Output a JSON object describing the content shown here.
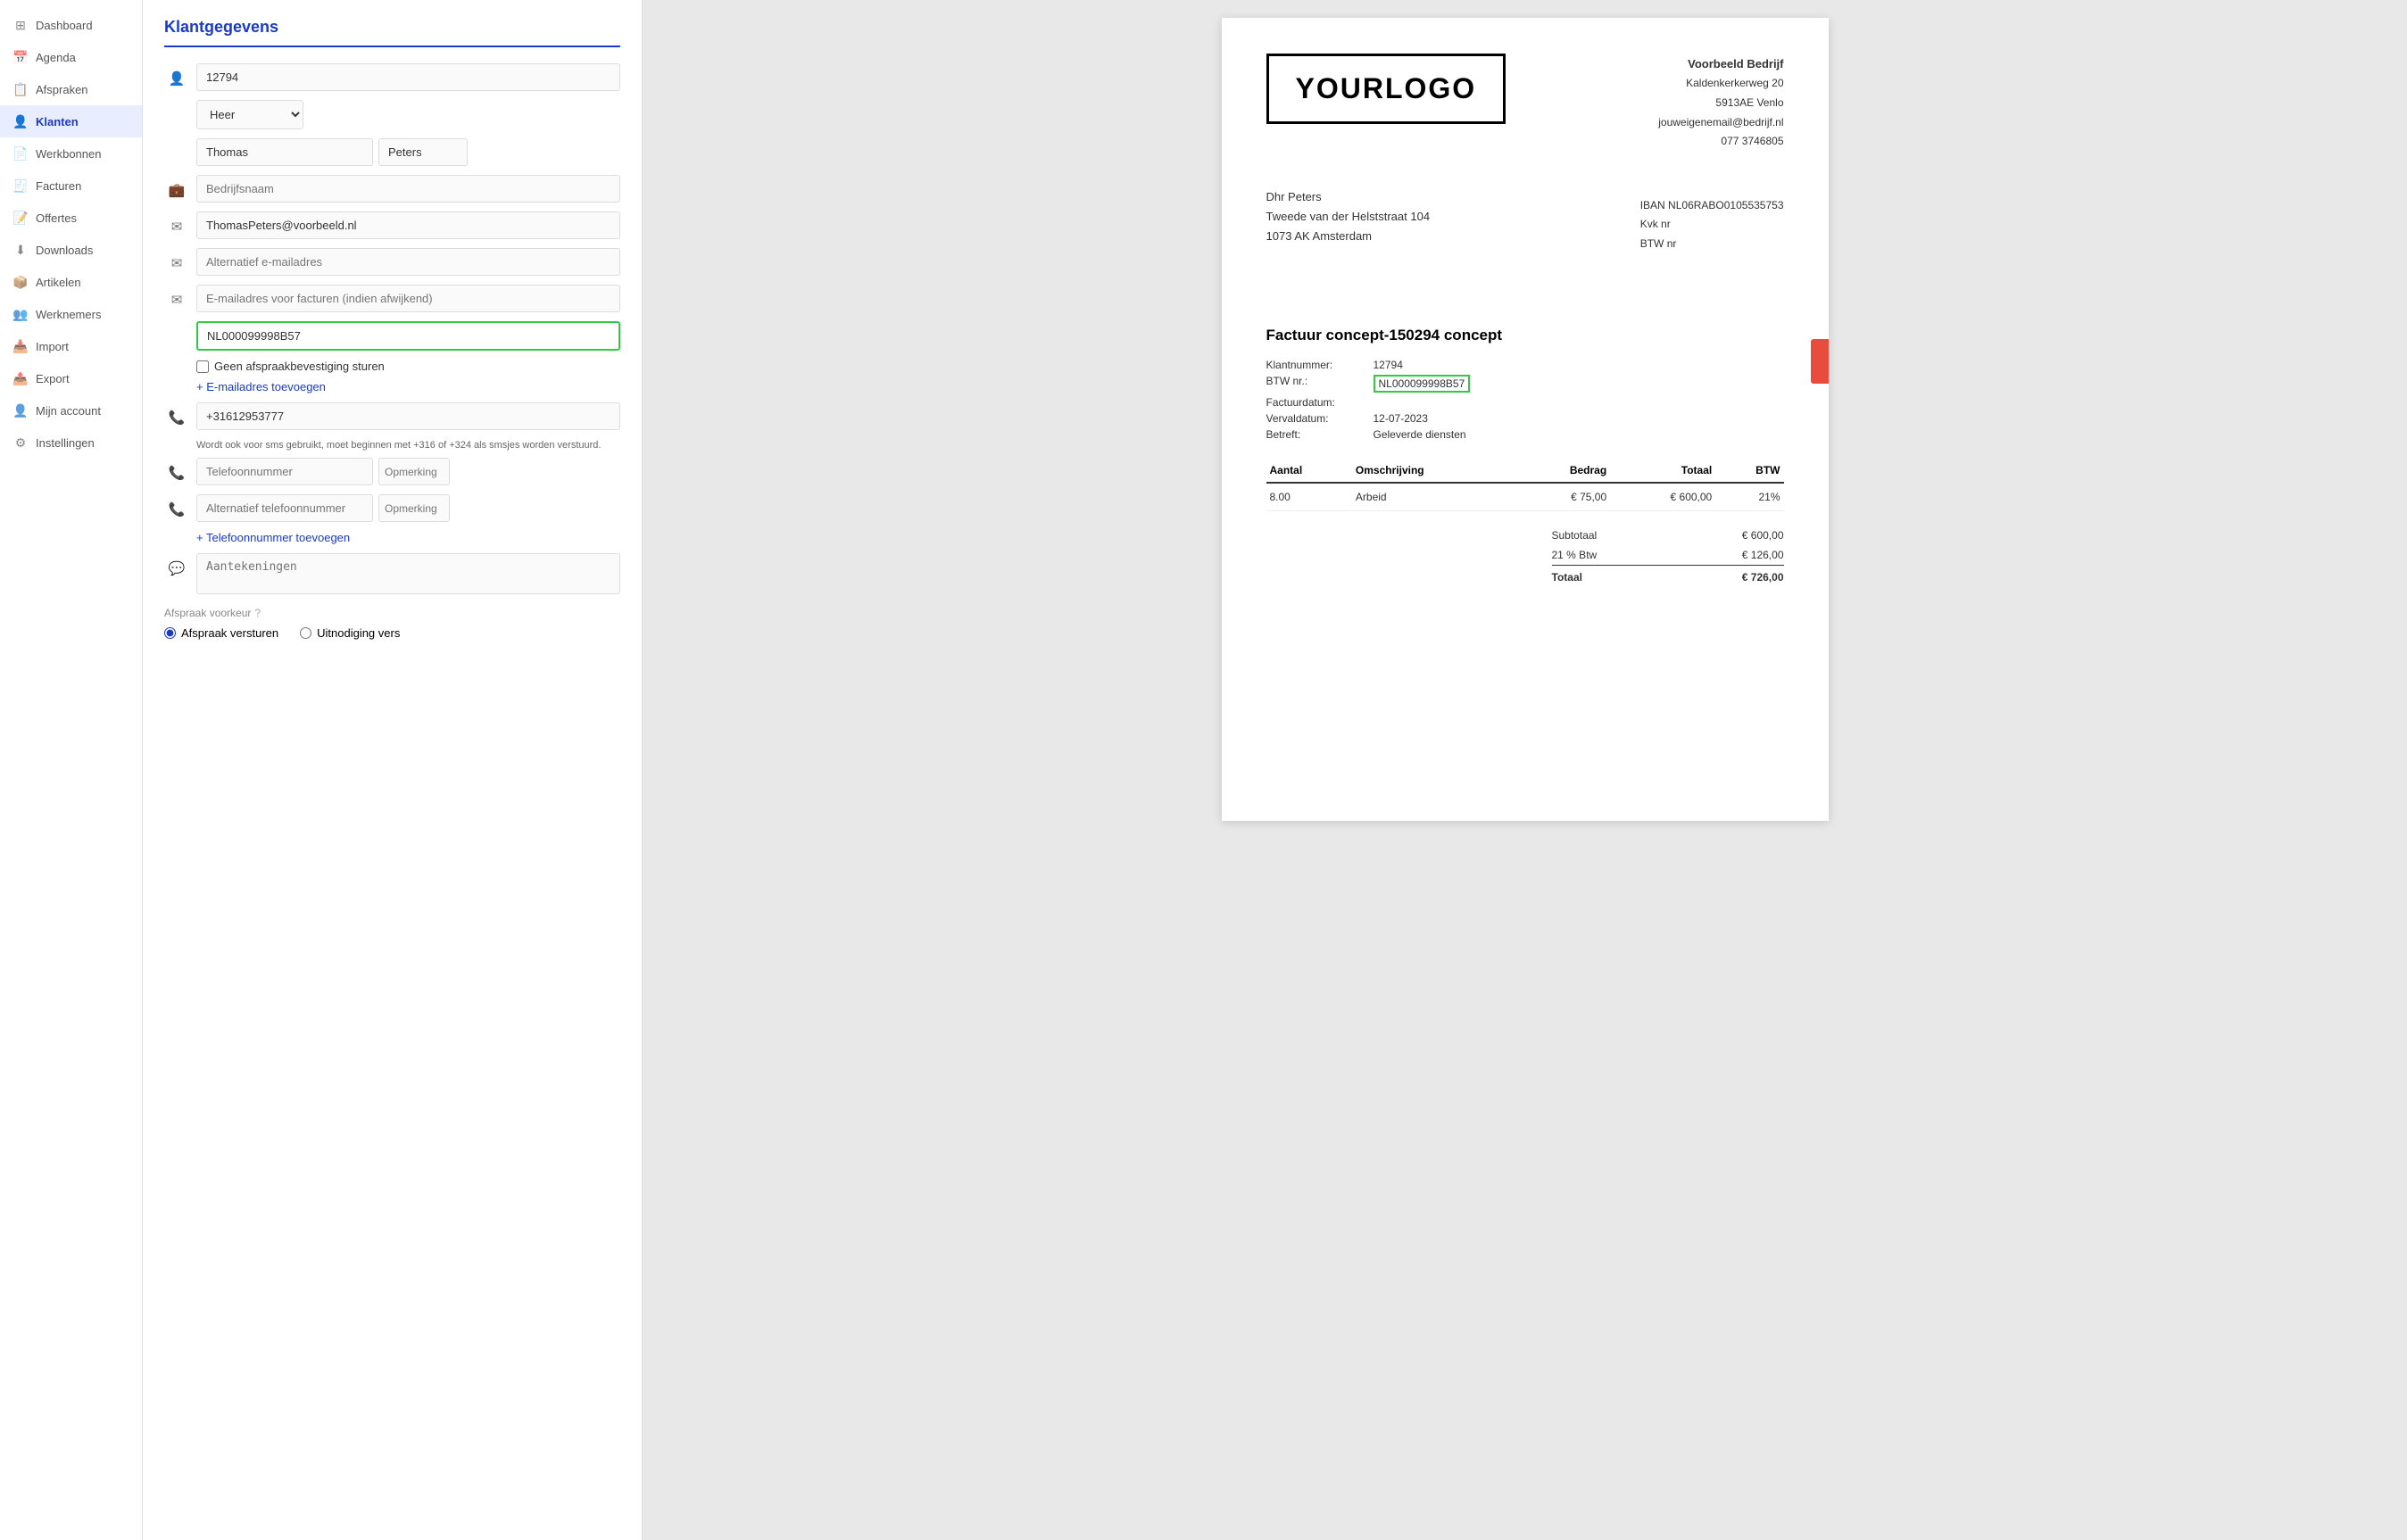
{
  "sidebar": {
    "items": [
      {
        "label": "Dashboard",
        "icon": "⊞",
        "id": "dashboard",
        "active": false
      },
      {
        "label": "Agenda",
        "icon": "📅",
        "id": "agenda",
        "active": false
      },
      {
        "label": "Afspraken",
        "icon": "📋",
        "id": "afspraken",
        "active": false
      },
      {
        "label": "Klanten",
        "icon": "👤",
        "id": "klanten",
        "active": true
      },
      {
        "label": "Werkbonnen",
        "icon": "📄",
        "id": "werkbonnen",
        "active": false
      },
      {
        "label": "Facturen",
        "icon": "🧾",
        "id": "facturen",
        "active": false
      },
      {
        "label": "Offertes",
        "icon": "📝",
        "id": "offertes",
        "active": false
      },
      {
        "label": "Downloads",
        "icon": "⬇",
        "id": "downloads",
        "active": false
      },
      {
        "label": "Artikelen",
        "icon": "📦",
        "id": "artikelen",
        "active": false
      },
      {
        "label": "Werknemers",
        "icon": "👥",
        "id": "werknemers",
        "active": false
      },
      {
        "label": "Import",
        "icon": "📥",
        "id": "import",
        "active": false
      },
      {
        "label": "Export",
        "icon": "📤",
        "id": "export",
        "active": false
      },
      {
        "label": "Mijn account",
        "icon": "👤",
        "id": "mijn-account",
        "active": false
      },
      {
        "label": "Instellingen",
        "icon": "⚙",
        "id": "instellingen",
        "active": false
      }
    ]
  },
  "form": {
    "title": "Klantgegevens",
    "klantnummer": "12794",
    "aanhef": "Heer",
    "voornaam": "Thomas",
    "achternaam": "Peters",
    "bedrijfsnaam_placeholder": "Bedrijfsnaam",
    "email": "ThomasPeters@voorbeeld.nl",
    "alt_email_placeholder": "Alternatief e-mailadres",
    "factuur_email_placeholder": "E-mailadres voor facturen (indien afwijkend)",
    "btw_nummer": "NL000099998B57",
    "geen_afspraak_label": "Geen afspraakbevestiging sturen",
    "add_email_label": "+ E-mailadres toevoegen",
    "telefoon": "+31612953777",
    "telefoon_hint": "Wordt ook voor sms gebruikt, moet beginnen met +316 of +324 als smsjes worden verstuurd.",
    "telefoonnummer_placeholder": "Telefoonnummer",
    "alt_telefoon_placeholder": "Alternatief telefoonnummer",
    "opmerking_label": "Opmerking",
    "add_telefoon_label": "+ Telefoonnummer toevoegen",
    "aantekeningen_placeholder": "Aantekeningen",
    "afspraak_voorkeur_label": "Afspraak voorkeur",
    "afspraak_versturen_label": "Afspraak versturen",
    "uitnodiging_label": "Uitnodiging vers"
  },
  "invoice": {
    "logo_text": "YOURLOGO",
    "company_name": "Voorbeeld Bedrijf",
    "company_address": "Kaldenkerkerweg 20",
    "company_city": "5913AE Venlo",
    "company_email": "jouweigenemail@bedrijf.nl",
    "company_phone": "077 3746805",
    "iban": "IBAN NL06RABO0105535753",
    "kvk_label": "Kvk nr",
    "btw_label_company": "BTW nr",
    "recipient_name": "Dhr Peters",
    "recipient_address": "Tweede van der Helststraat 104",
    "recipient_city": "1073 AK Amsterdam",
    "invoice_title": "Factuur concept-150294 concept",
    "meta": [
      {
        "label": "Klantnummer:",
        "value": "12794"
      },
      {
        "label": "BTW nr.:",
        "value": "NL000099998B57",
        "highlight": true
      },
      {
        "label": "Factuurdatum:",
        "value": ""
      },
      {
        "label": "Vervaldatum:",
        "value": "12-07-2023"
      },
      {
        "label": "Betreft:",
        "value": "Geleverde diensten"
      }
    ],
    "table_headers": [
      "Aantal",
      "Omschrijving",
      "Bedrag",
      "Totaal",
      "BTW"
    ],
    "table_rows": [
      {
        "aantal": "8.00",
        "omschrijving": "Arbeid",
        "bedrag": "€ 75,00",
        "totaal": "€ 600,00",
        "btw": "21%"
      }
    ],
    "subtotaal_label": "Subtotaal",
    "subtotaal_value": "€ 600,00",
    "btw_row_label": "21 % Btw",
    "btw_row_value": "€ 126,00",
    "totaal_label": "Totaal",
    "totaal_value": "€ 726,00"
  }
}
